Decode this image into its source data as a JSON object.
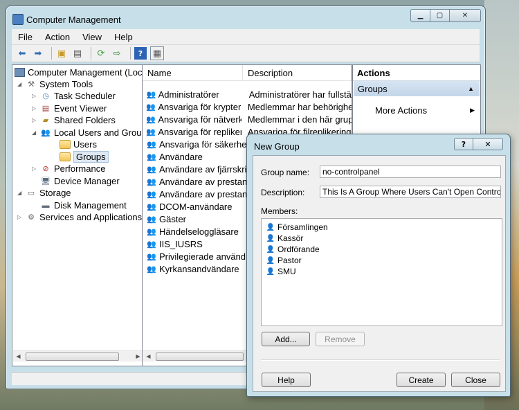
{
  "window": {
    "title": "Computer Management",
    "caption": {
      "minimize": "▁",
      "maximize": "▢",
      "close": "✕"
    }
  },
  "menu": [
    "File",
    "Action",
    "View",
    "Help"
  ],
  "toolbar_icons": [
    "back-arrow-icon",
    "forward-arrow-icon",
    "up-folder-icon",
    "show-hide-tree-icon",
    "refresh-icon",
    "export-list-icon",
    "help-icon",
    "properties-icon"
  ],
  "tree": {
    "root": "Computer Management (Local",
    "system_tools": "System Tools",
    "task_scheduler": "Task Scheduler",
    "event_viewer": "Event Viewer",
    "shared_folders": "Shared Folders",
    "local_users_groups": "Local Users and Groups",
    "users": "Users",
    "groups": "Groups",
    "performance": "Performance",
    "device_manager": "Device Manager",
    "storage": "Storage",
    "disk_management": "Disk Management",
    "services_apps": "Services and Applications"
  },
  "list": {
    "headers": {
      "name": "Name",
      "description": "Description"
    },
    "rows": [
      {
        "name": "Administratörer",
        "desc": "Administratörer har fullständ"
      },
      {
        "name": "Ansvariga för krypteri...",
        "desc": "Medlemmar har behörighet a"
      },
      {
        "name": "Ansvariga för nätverks...",
        "desc": "Medlemmar i den här gruppe"
      },
      {
        "name": "Ansvariga för replikeri...",
        "desc": "Ansvariga för filreplikering i e"
      },
      {
        "name": "Ansvariga för säkerhet...",
        "desc": ""
      },
      {
        "name": "Användare",
        "desc": ""
      },
      {
        "name": "Användare av fjärrskri...",
        "desc": ""
      },
      {
        "name": "Användare av prestan...",
        "desc": ""
      },
      {
        "name": "Användare av prestan...",
        "desc": ""
      },
      {
        "name": "DCOM-användare",
        "desc": ""
      },
      {
        "name": "Gäster",
        "desc": ""
      },
      {
        "name": "Händelseloggläsare",
        "desc": ""
      },
      {
        "name": "IIS_IUSRS",
        "desc": ""
      },
      {
        "name": "Privilegierade använd...",
        "desc": ""
      },
      {
        "name": "Kyrkansandvändare",
        "desc": ""
      }
    ]
  },
  "actions": {
    "header": "Actions",
    "group": "Groups",
    "more": "More Actions"
  },
  "dialog": {
    "title": "New Group",
    "help_glyph": "?",
    "close_glyph": "✕",
    "group_name_label": "Group name:",
    "group_name_value": "no-controlpanel",
    "description_label": "Description:",
    "description_value": "This Is A Group Where Users Can't Open Control Panel",
    "members_label": "Members:",
    "members": [
      "Församlingen",
      "Kassör",
      "Ordförande",
      "Pastor",
      "SMU"
    ],
    "add_button": "Add...",
    "remove_button": "Remove",
    "help_button": "Help",
    "create_button": "Create",
    "close_button": "Close"
  }
}
